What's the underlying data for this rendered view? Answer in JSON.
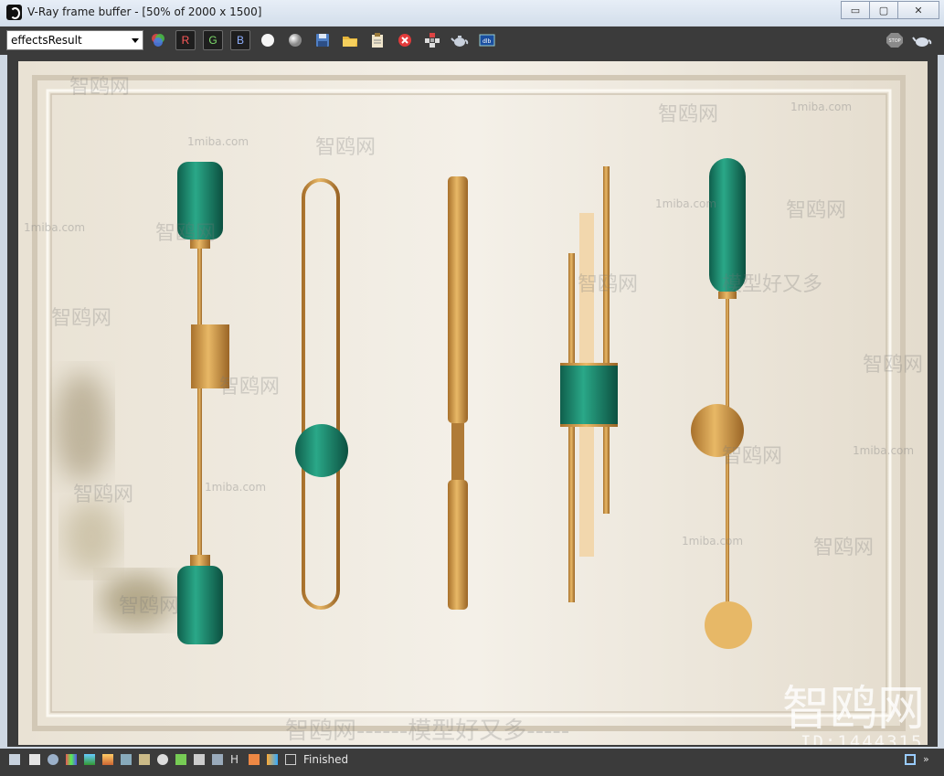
{
  "window": {
    "title": "V-Ray frame buffer - [50% of 2000 x 1500]",
    "controls": {
      "minimize": "▭",
      "maximize": "▢",
      "close": "✕"
    }
  },
  "toolbar": {
    "channel_value": "effectsResult",
    "r_label": "R",
    "g_label": "G",
    "b_label": "B",
    "icons": [
      "color-wheel-icon",
      "white-circle-icon",
      "gray-circle-icon",
      "save-icon",
      "open-folder-icon",
      "clipboard-icon",
      "clear-icon",
      "region-render-icon",
      "teapot-icon",
      "history-icon",
      "stop-render-icon",
      "render-teapot-icon"
    ]
  },
  "render": {
    "watermark_logo": "智鸥网",
    "watermark_site": "1miba.com",
    "watermark_slogan": "模型好又多",
    "watermark_bottom": "智鸥网------模型好又多-----",
    "watermark_large": "智鸥网",
    "watermark_id": "ID:1444315",
    "colors": {
      "brass": "#c8913f",
      "teal": "#1f8f72",
      "wall": "#efe9df"
    }
  },
  "statusbar": {
    "status": "Finished"
  }
}
